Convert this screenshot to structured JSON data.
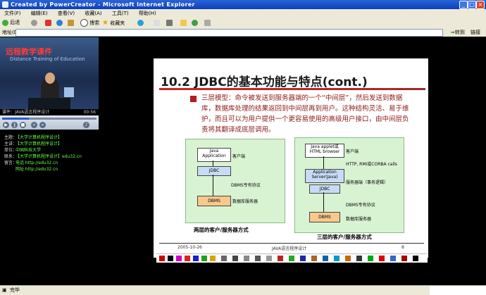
{
  "window": {
    "title": "Created by PowerCreator - Microsoft Internet Explorer"
  },
  "menu": [
    "文件(F)",
    "编辑(E)",
    "查看(V)",
    "收藏(A)",
    "工具(T)",
    "帮助(H)"
  ],
  "toolbar": {
    "back": "后退",
    "search": "搜索",
    "favorites": "收藏夹"
  },
  "address": {
    "label": "地址(D)",
    "go": "转到",
    "links": "链接"
  },
  "video": {
    "title": "远程教学课件",
    "subtitle": "Distance Training of Education",
    "info_left": "课件：JAVA语言程序设计",
    "info_right": "00:56"
  },
  "player": {
    "progress": 0.28
  },
  "course_info": [
    {
      "k": "主题：",
      "v": "【大学计算机程序设计】"
    },
    {
      "k": "主讲：",
      "v": "【大学计算机程序设计】"
    },
    {
      "k": "单位：",
      "v": "中国科技大学"
    },
    {
      "k": "联系：",
      "v": "【大学计算机程序设计】edu32.cn"
    },
    {
      "k": "留言：",
      "v": "电话 http://edu32.cn"
    },
    {
      "k": "",
      "v": "网址 http://edu32.cn"
    }
  ],
  "slide": {
    "title": "10.2 JDBC的基本功能与特点(cont.)",
    "paragraph": "三层模型：命令被发送到服务器端的一个“中间层”，然后发送到数据库，数据库处理的结果返回到中间层再到用户。这种结构灵活、易于维护，而且可以为用户提供一个更容易使用的高级用户接口，由中间层负责将其翻译成底层调用。",
    "left_diagram": {
      "box_top": "Java Application",
      "box_mid": "JDBC",
      "box_bot": "DBMS",
      "label_top": "客户端",
      "label_mid": "DBMS专有协议",
      "label_bot": "数据库服务器",
      "caption": "两层的客户/服务器方式"
    },
    "right_diagram": {
      "box_top": "Java applet或HTML browser",
      "box_mid": "Application Server(Java)",
      "box_jdbc": "JDBC",
      "box_bot": "DBMS",
      "label_top": "客户端",
      "label_http": "HTTP, RMI或CORBA calls",
      "label_mid": "服务器端（事务逻辑）",
      "label_proto": "DBMS专有协议",
      "label_bot": "数据库服务器",
      "caption": "三层的客户/服务器方式"
    },
    "footer_date": "2005-10-26",
    "footer_course": "JAVA语言程序设计",
    "footer_page": "8"
  },
  "status": {
    "text": "完毕"
  },
  "colors": {
    "slide_title_rule": "#c82828",
    "paragraph": "#8b1a1a",
    "diagram_bg": "#d8f3d2",
    "dbms_box": "#f8c98c",
    "jdbc_box": "#c7dbf5"
  }
}
